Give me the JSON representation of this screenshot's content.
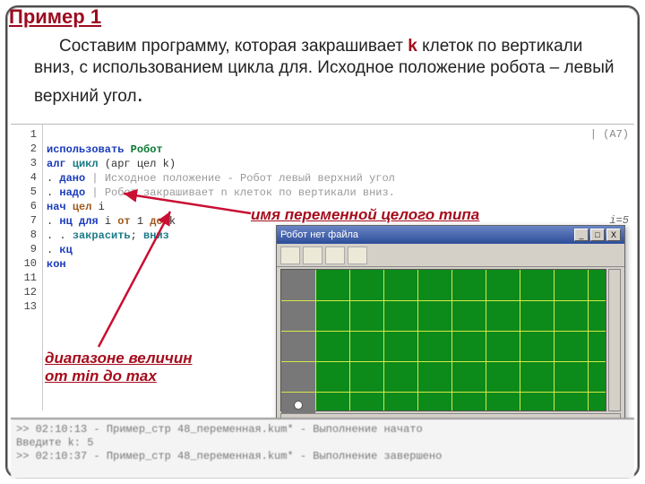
{
  "title": "Пример 1",
  "body": {
    "part1": "Составим программу, которая закрашивает ",
    "k": "k",
    "part2": " клеток по вертикали вниз, с использованием цикла для. Исходное положение робота – левый верхний угол",
    "dot": "."
  },
  "gutter": [
    "1",
    "2",
    "3",
    "4",
    "5",
    "6",
    "7",
    "8",
    "9",
    "10",
    "11",
    "12",
    "13"
  ],
  "code": {
    "l1a": "использовать ",
    "l1b": "Робот",
    "l2a": "алг ",
    "l2b": "цикл ",
    "l2c": "(арг цел k)",
    "l3a": ". ",
    "l3b": "дано",
    "l3c": " | Исходное положение - Робот левый верхний угол",
    "l4a": ". ",
    "l4b": "надо",
    "l4c": " | Робот закрашивает n клеток по вертикали вниз.",
    "l5a": "нач ",
    "l5b": "цел ",
    "l5c": "i",
    "l6a": ". ",
    "l6b": "нц для ",
    "l6c": "i ",
    "l6d": "от ",
    "l6e": "1 ",
    "l6f": "до ",
    "l6g": "k",
    "l7a": ". . ",
    "l7b": "закрасить",
    "l7c": "; ",
    "l7d": "вниз",
    "l8a": ". ",
    "l8b": "кц",
    "l9": "кон"
  },
  "a7": "| (A7)",
  "i5": "i=5",
  "anno1": "имя переменной целого типа",
  "anno2_l1": "диапазоне величин",
  "anno2_l2": "от min до max",
  "robot": {
    "title": "Робот  нет файла",
    "btn_min": "_",
    "btn_max": "□",
    "btn_close": "X"
  },
  "console": {
    "l1": ">> 02:10:13 - Пример_стр 48_переменная.kum* - Выполнение начато",
    "l2": "Введите k: 5",
    "l3": ">> 02:10:37 - Пример_стр 48_переменная.kum* - Выполнение завершено"
  }
}
